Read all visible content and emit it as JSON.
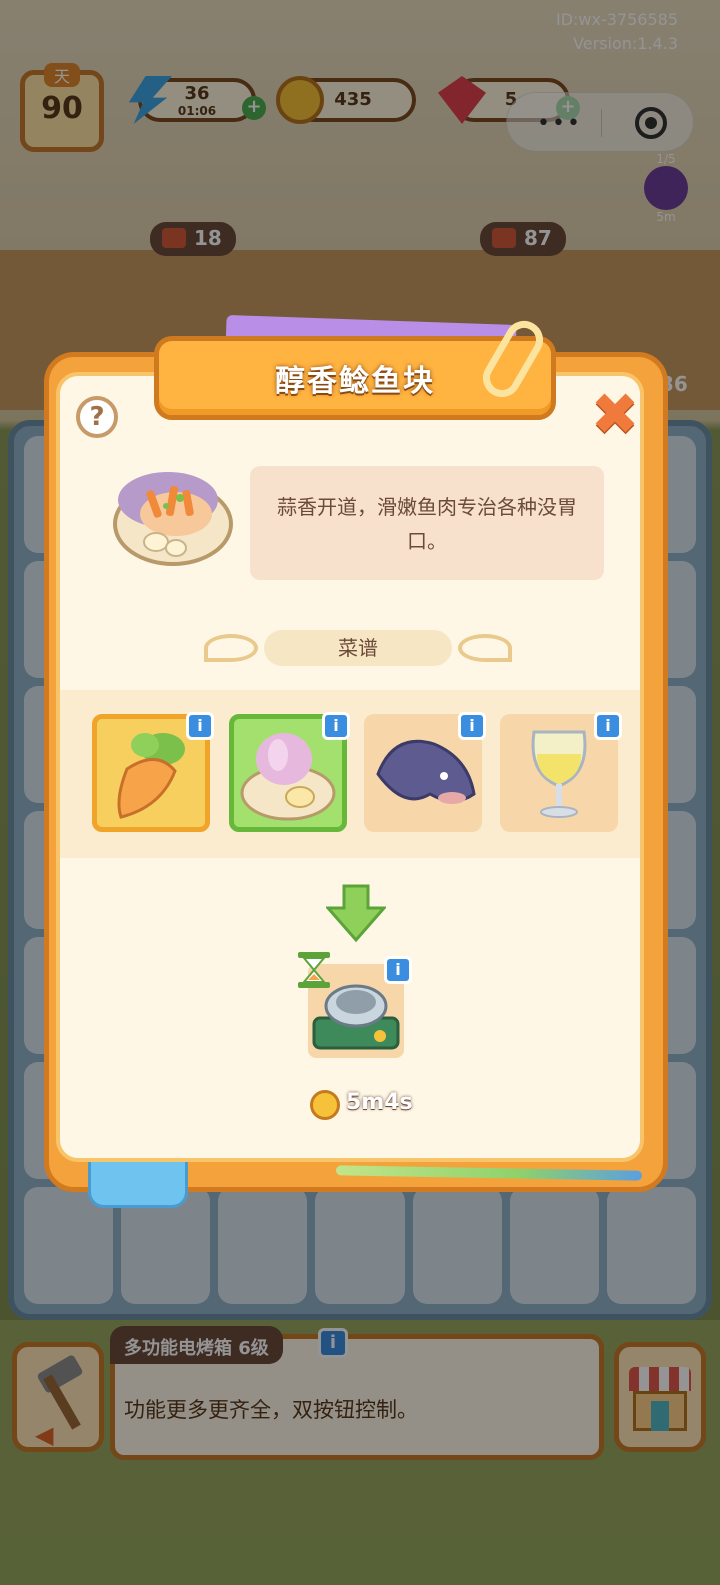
{
  "system": {
    "id_text": "ID:wx-3756585",
    "version_text": "Version:1.4.3",
    "menu_dots": "•••"
  },
  "hud": {
    "day_label": "天",
    "day_value": "90",
    "energy_value": "36",
    "energy_timer": "01:06",
    "coins": "435",
    "gems": "5"
  },
  "orders": {
    "left_reward": "18",
    "right_reward": "87",
    "side_text": "36",
    "top_right_count": "1/5",
    "top_right_timer": "5m"
  },
  "popup": {
    "title": "醇香鲶鱼块",
    "help_symbol": "?",
    "close_symbol": "✖",
    "description": "蒜香开道，滑嫩鱼肉专治各种没胃口。",
    "recipe_label": "菜谱",
    "ingredients": [
      {
        "name": "carrot",
        "info": "i"
      },
      {
        "name": "garlic",
        "info": "i"
      },
      {
        "name": "catfish",
        "info": "i"
      },
      {
        "name": "wine",
        "info": "i"
      }
    ],
    "appliance_info": "i",
    "cook_time": "5m4s"
  },
  "bottom": {
    "appliance_title": "多功能电烤箱 6级",
    "appliance_info": "i",
    "appliance_desc": "功能更多更齐全，双按钮控制。"
  },
  "colors": {
    "popup_orange": "#f4a33c",
    "panel_cream": "#fff7e6",
    "info_blue": "#3b8de0",
    "title_banner": "#ffb341"
  }
}
